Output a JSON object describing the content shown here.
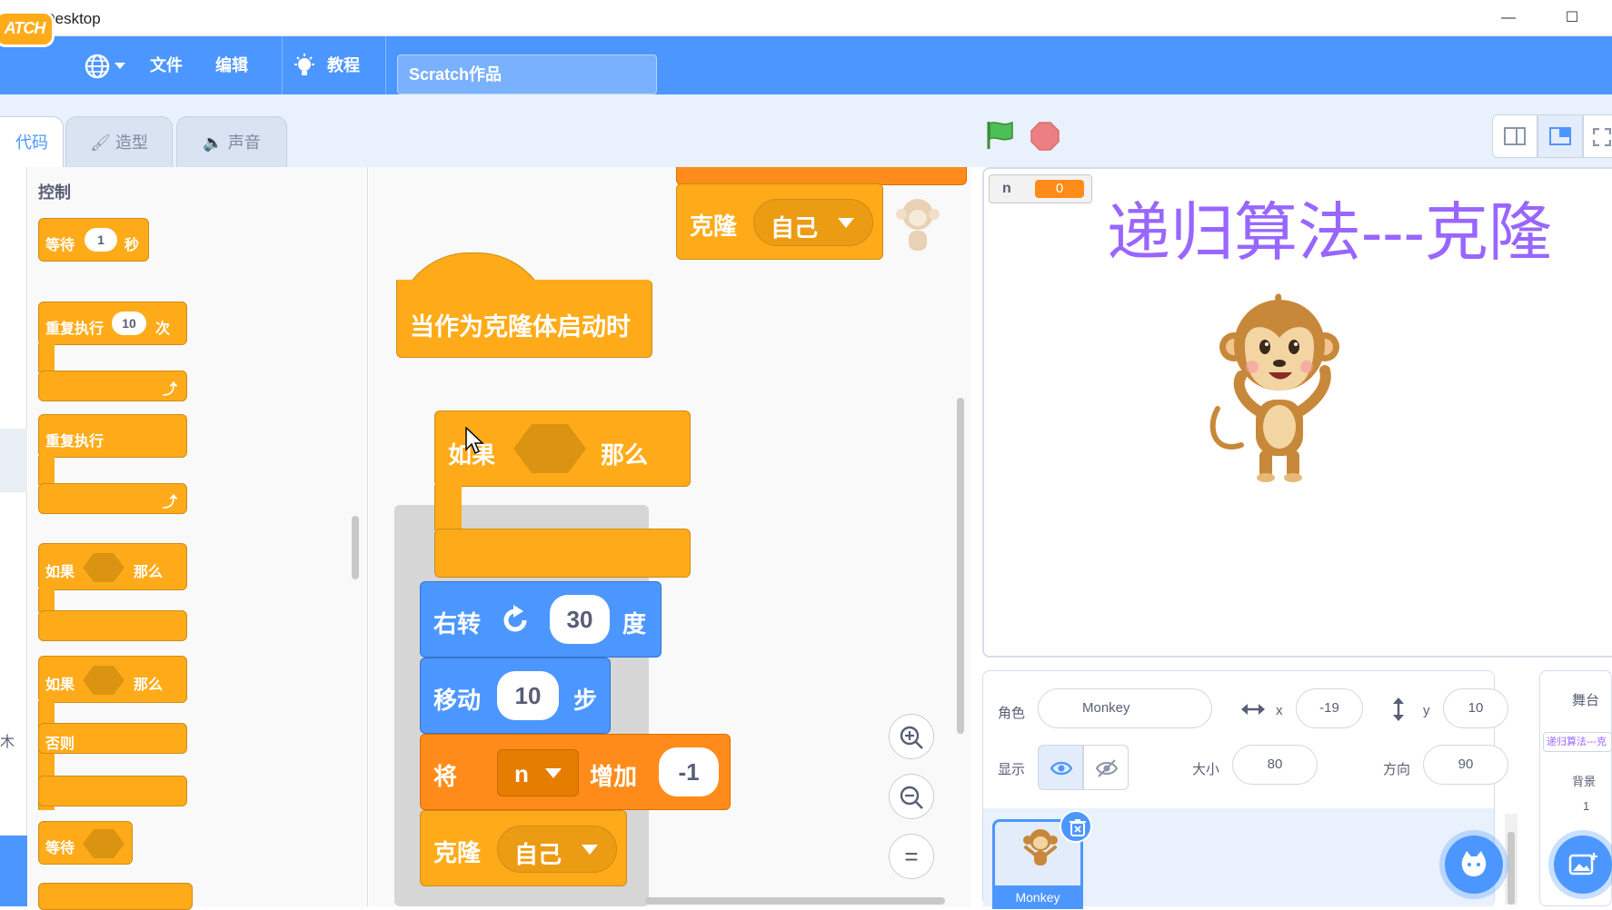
{
  "window": {
    "title": "Scratch Desktop",
    "minimize": "—",
    "maximize": "☐"
  },
  "menu": {
    "logo_text": "ATCH",
    "file": "文件",
    "edit": "编辑",
    "tutorials": "教程",
    "project_title": "Scratch作品"
  },
  "tabs": {
    "code": "代码",
    "costumes": "造型",
    "sounds": "声音"
  },
  "palette": {
    "heading": "控制",
    "wait": "等待",
    "wait_val": "1",
    "wait_unit": "秒",
    "repeat": "重复执行",
    "repeat_val": "10",
    "repeat_unit": "次",
    "forever": "重复执行",
    "if": "如果",
    "then": "那么",
    "if2": "如果",
    "then2": "那么",
    "else": "否则",
    "wait_until": "等待",
    "left_stub": "木"
  },
  "script": {
    "clone_top": "克隆",
    "clone_top_menu": "自己",
    "hat": "当作为克隆体启动时",
    "if": "如果",
    "then": "那么",
    "turn": "右转",
    "turn_val": "30",
    "turn_unit": "度",
    "move": "移动",
    "move_val": "10",
    "move_unit": "步",
    "change": "将",
    "change_var": "n",
    "change_by": "增加",
    "change_val": "-1",
    "clone": "克隆",
    "clone_menu": "自己",
    "zoom_in": "+",
    "zoom_out": "−",
    "zoom_reset": "="
  },
  "stage": {
    "monitor_name": "n",
    "monitor_value": "0",
    "title": "递归算法---克隆"
  },
  "sprite_info": {
    "sprite_label": "角色",
    "sprite_name": "Monkey",
    "x_label": "x",
    "x_value": "-19",
    "y_label": "y",
    "y_value": "10",
    "show_label": "显示",
    "size_label": "大小",
    "size_value": "80",
    "direction_label": "方向",
    "direction_value": "90",
    "sprite_thumb_label": "Monkey"
  },
  "stage_pane": {
    "label": "舞台",
    "backdrop_thumb": "递归算法---克",
    "backdrops_label": "背景",
    "backdrops_count": "1"
  },
  "colors": {
    "menu_blue": "#4c97ff",
    "control": "#ffab19",
    "motion": "#4c97ff",
    "variables": "#ff8c1a",
    "title_purple": "#9966ff"
  }
}
